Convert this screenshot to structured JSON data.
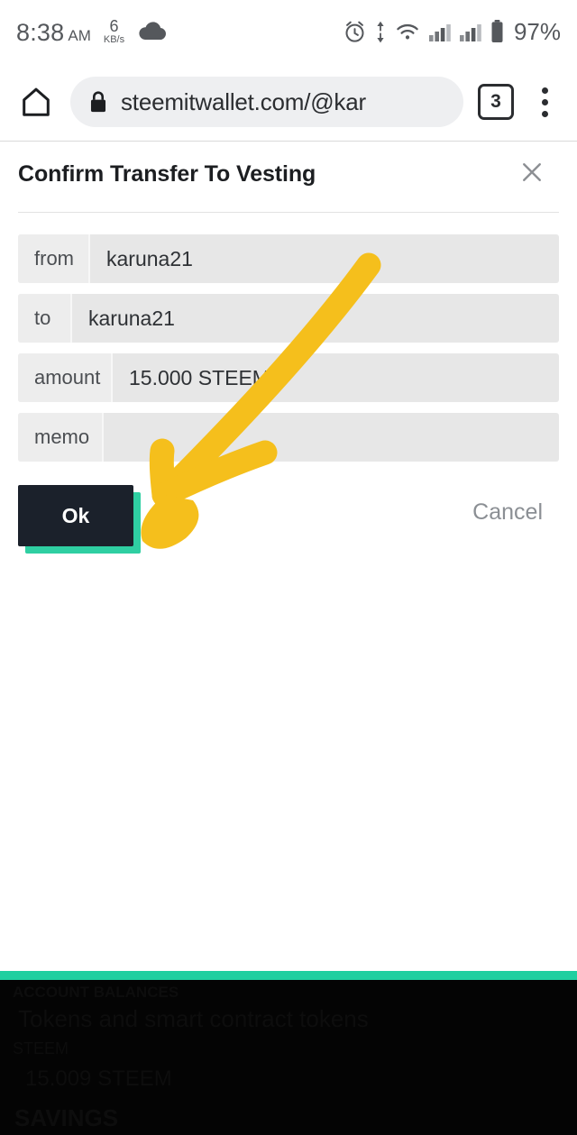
{
  "status_bar": {
    "time": "8:38",
    "ampm": "AM",
    "data_speed_value": "6",
    "data_speed_unit": "KB/s",
    "cloud_icon": "cloud-icon",
    "alarm_icon": "alarm-clock-icon",
    "data_transfer_icon": "data-transfer-arrows-icon",
    "wifi_icon": "wifi-icon",
    "signal_icon_1": "signal-bars-icon",
    "signal_icon_2": "signal-bars-icon",
    "battery_icon": "battery-icon",
    "battery_percent": "97%",
    "text_color": "#55585c"
  },
  "browser": {
    "home_icon": "home-icon",
    "lock_icon": "lock-icon",
    "url": "steemitwallet.com/@kar",
    "tab_count": "3",
    "menu_icon": "three-dot-menu-icon",
    "omnibox_bg": "#eeeff1"
  },
  "dialog": {
    "title": "Confirm Transfer To Vesting",
    "close_icon": "close-x-icon",
    "fields": [
      {
        "label": "from",
        "value": "karuna21"
      },
      {
        "label": "to",
        "value": "karuna21"
      },
      {
        "label": "amount",
        "value": "15.000 STEEM"
      },
      {
        "label": "memo",
        "value": ""
      }
    ],
    "ok_label": "Ok",
    "cancel_label": "Cancel",
    "ok_bg": "#1b212b",
    "ok_shadow": "#2fcfa2",
    "cancel_color": "#8b8f94"
  },
  "annotation": {
    "arrow_icon": "hand-drawn-arrow-icon",
    "arrow_color": "#F5BF1C",
    "points_to": "Ok"
  },
  "bottom_panel": {
    "accent_bar_color": "#1fcfa0",
    "background": "#040404",
    "lines": [
      "ACCOUNT BALANCES",
      "Tokens and smart contract tokens",
      "STEEM",
      "15.009 STEEM",
      "SAVINGS"
    ]
  }
}
